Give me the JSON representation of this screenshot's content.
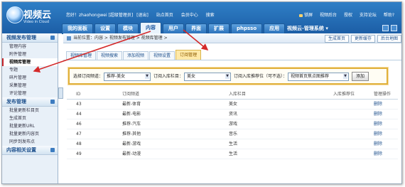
{
  "brand": {
    "name": "视频云",
    "sub": "Video in Cloud"
  },
  "user": {
    "greeting": "您好！zhaohongwei [超级管理员]",
    "logout": "[退出]",
    "site_home": "站点首页",
    "member_center": "会员中心",
    "search": "搜索"
  },
  "top_links": [
    "锁屏",
    "视频后台",
    "授权",
    "支持论坛",
    "帮助?"
  ],
  "nav": {
    "tabs": [
      "我的面板",
      "设置",
      "模块",
      "内容",
      "用户",
      "界面",
      "扩展",
      "phpsso",
      "应用"
    ],
    "active_index": 3,
    "system_menu": "视频云-管理系统 ▾"
  },
  "sidebar": {
    "sections": [
      {
        "title": "视频发布管理",
        "items": [
          "管理内容",
          "附件管理",
          "视频库管理",
          "专题",
          "碎片管理",
          "采集管理",
          "评论管理"
        ]
      },
      {
        "title": "发布管理",
        "items": [
          "批量更新栏目页",
          "生成首页",
          "批量更新URL",
          "批量更新内容页",
          "同步到发布点"
        ]
      },
      {
        "title": "内容相关设置",
        "items": []
      }
    ],
    "active_item": "视频库管理"
  },
  "breadcrumb": {
    "text": "当前位置：内容 > 视频发布管理 > 视频库管理 >",
    "actions": [
      "生成首页",
      "更新缓存",
      "后台地图"
    ]
  },
  "subtabs": {
    "items": [
      "视频库管理",
      "视频搜索",
      "添加视频",
      "视频设置",
      "订阅管理"
    ],
    "active_index": 4
  },
  "filter": {
    "channel_label": "选择订阅频道：",
    "channel_value": "推荐-美女",
    "column_label": "订阅入库栏目：",
    "column_value": "美女",
    "position_label": "订阅入库推荐位（可不选）：",
    "position_value": "视频首页焦点图推荐",
    "add_button": "添加"
  },
  "table": {
    "headers": [
      "ID",
      "订阅频道",
      "入库栏目",
      "入库推荐位",
      "管理操作"
    ],
    "rows": [
      {
        "id": "43",
        "channel": "最新-体育",
        "column": "美女",
        "position": "",
        "action": "删除"
      },
      {
        "id": "44",
        "channel": "最新-电影",
        "column": "资讯",
        "position": "",
        "action": "删除"
      },
      {
        "id": "46",
        "channel": "推荐-汽车",
        "column": "游戏",
        "position": "",
        "action": "删除"
      },
      {
        "id": "47",
        "channel": "推荐-其他",
        "column": "音乐",
        "position": "",
        "action": "删除"
      },
      {
        "id": "48",
        "channel": "最新-游戏",
        "column": "生活",
        "position": "",
        "action": "删除"
      },
      {
        "id": "49",
        "channel": "最新-动漫",
        "column": "生活",
        "position": "",
        "action": "删除"
      }
    ]
  },
  "colors": {
    "topbar": "#1c5ea6",
    "highlight_border": "#e0b13d",
    "arrow": "#d42a2a",
    "active_subtab": "#ffe9a8"
  }
}
